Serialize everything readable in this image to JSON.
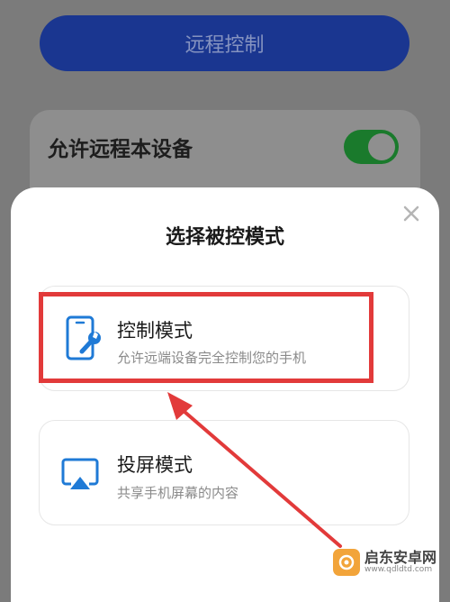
{
  "background": {
    "remote_control_button": "远程控制",
    "allow_remote_label": "允许远程本设备",
    "allow_remote_enabled": true
  },
  "sheet": {
    "title": "选择被控模式",
    "options": [
      {
        "title": "控制模式",
        "desc": "允许远端设备完全控制您的手机",
        "icon": "phone-wrench-icon",
        "highlighted": true
      },
      {
        "title": "投屏模式",
        "desc": "共享手机屏幕的内容",
        "icon": "screen-cast-icon",
        "highlighted": false
      }
    ]
  },
  "annotation": {
    "highlight_color": "#e23a3a",
    "arrow_color": "#e23a3a"
  },
  "watermark": {
    "name": "启东安卓网",
    "url": "www.qdldtd.com"
  },
  "colors": {
    "primary": "#1a3690",
    "toggle_on": "#1a7a2c",
    "icon_blue": "#1f7ad6"
  }
}
